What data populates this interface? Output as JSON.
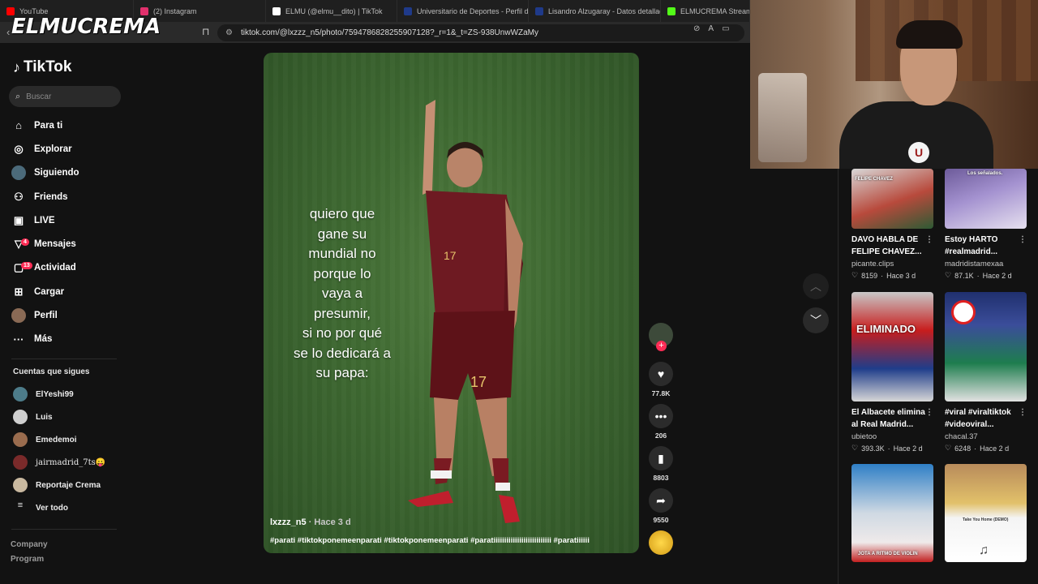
{
  "browser": {
    "tabs": [
      {
        "label": "YouTube",
        "color": "#ff0000"
      },
      {
        "label": "(2) Instagram",
        "color": "#e1306c"
      },
      {
        "label": "ELMU (@elmu__dito) | TikTok",
        "color": "#ffffff"
      },
      {
        "label": "Universitario de Deportes - Perfil de",
        "color": "#1f3a8a"
      },
      {
        "label": "Lisandro Alzugaray - Datos detallad",
        "color": "#1f3a8a"
      },
      {
        "label": "ELMUCREMA Stream - W",
        "color": "#53fc18"
      }
    ],
    "url": "tiktok.com/@lxzzz_n5/photo/7594786828255907128?_r=1&_t=ZS-938UnwWZaMy",
    "watermark": "ELMUCREMA"
  },
  "sidebar": {
    "logo": "TikTok",
    "search_placeholder": "Buscar",
    "nav": [
      {
        "label": "Para ti",
        "icon": "home-icon",
        "glyph": "⌂"
      },
      {
        "label": "Explorar",
        "icon": "compass-icon",
        "glyph": "◎"
      },
      {
        "label": "Siguiendo",
        "icon": "following-avatar-icon",
        "glyph": ""
      },
      {
        "label": "Friends",
        "icon": "friends-icon",
        "glyph": "⚇"
      },
      {
        "label": "LIVE",
        "icon": "live-icon",
        "glyph": "▣"
      },
      {
        "label": "Mensajes",
        "icon": "messages-icon",
        "glyph": "▽",
        "badge": "4"
      },
      {
        "label": "Actividad",
        "icon": "activity-icon",
        "glyph": "▢",
        "badge": "13"
      },
      {
        "label": "Cargar",
        "icon": "upload-icon",
        "glyph": "⊞"
      },
      {
        "label": "Perfil",
        "icon": "profile-avatar-icon",
        "glyph": ""
      },
      {
        "label": "Más",
        "icon": "more-icon",
        "glyph": "···"
      }
    ],
    "following_title": "Cuentas que sigues",
    "following": [
      {
        "name": "ElYeshi99",
        "color": "#4d7c8a"
      },
      {
        "name": "Luis",
        "color": "#cfcfcf"
      },
      {
        "name": "Emedemoi",
        "color": "#9a6c4e"
      },
      {
        "name": "jairmadrid_7ts😛",
        "color": "#7a2a2a"
      },
      {
        "name": "Reportaje Crema",
        "color": "#c9b9a0"
      }
    ],
    "see_all": "Ver todo",
    "footer": [
      "Company",
      "Program"
    ]
  },
  "post": {
    "caption_lines": [
      "quiero que",
      "gane su",
      "mundial no",
      "porque lo",
      "vaya a",
      "presumir,",
      "si no por qué",
      "se lo dedicará a",
      "su papa:"
    ],
    "author": "lxzzz_n5",
    "time_ago": "· Hace 3 d",
    "hashtags": "#parati #tiktokponemeenparati #tiktokponemeenparati #paratiiiiiiiiiiiiiiiiiiiiiiiiiii #paratiiiiii",
    "likes": "77.8K",
    "comments": "206",
    "saves": "8803",
    "shares": "9550"
  },
  "recommendations": [
    {
      "title1": "DAVO HABLA DE",
      "title2": "FELIPE CHAVEZ...",
      "user": "picante.clips",
      "likes": "8159",
      "ago": "Hace 3 d",
      "thumb_text": "FELIPE CHAVEZ"
    },
    {
      "title1": "Estoy HARTO",
      "title2": "#realmadrid...",
      "user": "madridistamexaa",
      "likes": "87.1K",
      "ago": "Hace 2 d",
      "thumb_text": "Los señalados."
    },
    {
      "title1": "El Albacete elimina",
      "title2": "al Real Madrid...",
      "user": "ubietoo",
      "likes": "393.3K",
      "ago": "Hace 2 d",
      "thumb_text": "ELIMINADO"
    },
    {
      "title1": "#viral #viraltiktok",
      "title2": "#videoviral...",
      "user": "chacal.37",
      "likes": "6248",
      "ago": "Hace 2 d",
      "thumb_text": ""
    },
    {
      "title1": "",
      "title2": "",
      "user": "",
      "likes": "",
      "ago": "",
      "thumb_text": "JOTA A RITMO DE VIOLIN"
    },
    {
      "title1": "",
      "title2": "",
      "user": "",
      "likes": "",
      "ago": "",
      "thumb_text": "Take You Home (DEMO)"
    }
  ]
}
